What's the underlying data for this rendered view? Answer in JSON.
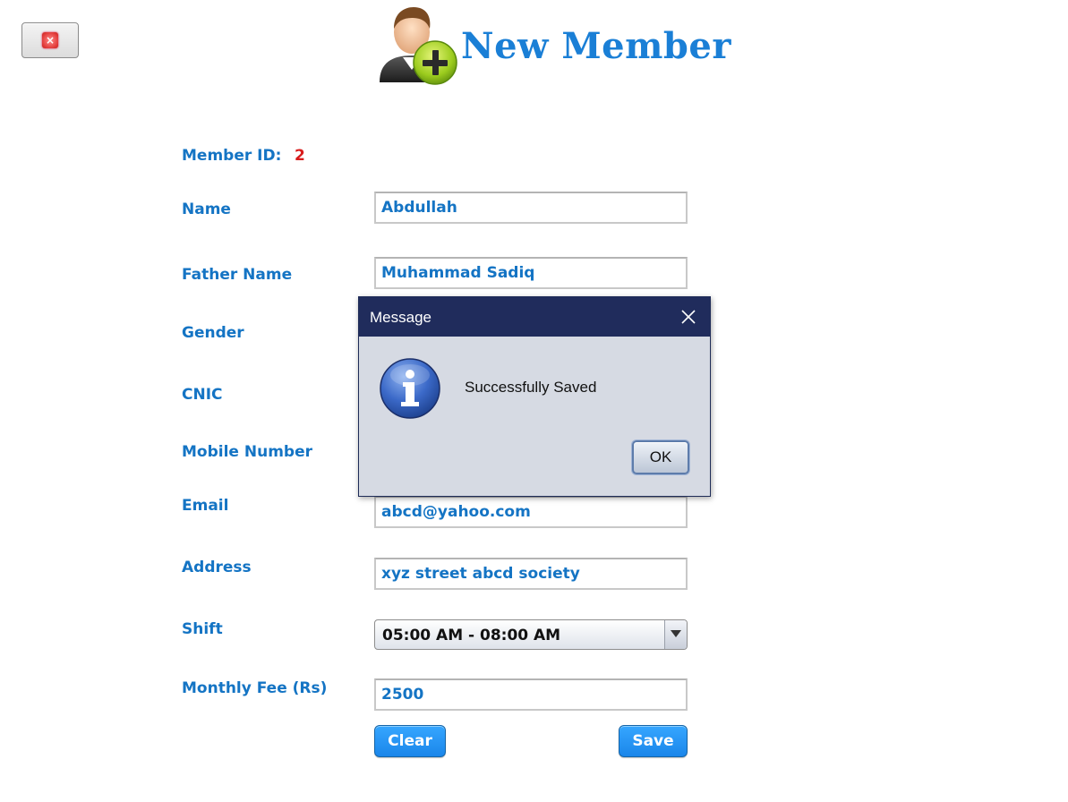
{
  "window": {
    "close_icon_glyph": "×"
  },
  "header": {
    "title": "New Member",
    "icon": "add-user-icon"
  },
  "form": {
    "member_id_label": "Member ID:",
    "member_id_value": "2",
    "name_label": "Name",
    "name_value": "Abdullah",
    "father_name_label": "Father Name",
    "father_name_value": "Muhammad Sadiq",
    "gender_label": "Gender",
    "cnic_label": "CNIC",
    "mobile_label": "Mobile Number",
    "email_label": "Email",
    "email_value": "abcd@yahoo.com",
    "address_label": "Address",
    "address_value": "xyz street abcd society",
    "shift_label": "Shift",
    "shift_value": "05:00 AM - 08:00 AM",
    "fee_label": "Monthly Fee (Rs)",
    "fee_value": "2500",
    "clear_label": "Clear",
    "save_label": "Save"
  },
  "dialog": {
    "title": "Message",
    "message": "Successfully Saved",
    "ok_label": "OK",
    "icon": "info-icon"
  },
  "colors": {
    "accent": "#1474c4",
    "title": "#1a7fd6",
    "member_id": "#d81c1c",
    "dialog_titlebar": "#202c5c",
    "dialog_body": "#d6dae3",
    "button_blue": "#1a86ea"
  }
}
